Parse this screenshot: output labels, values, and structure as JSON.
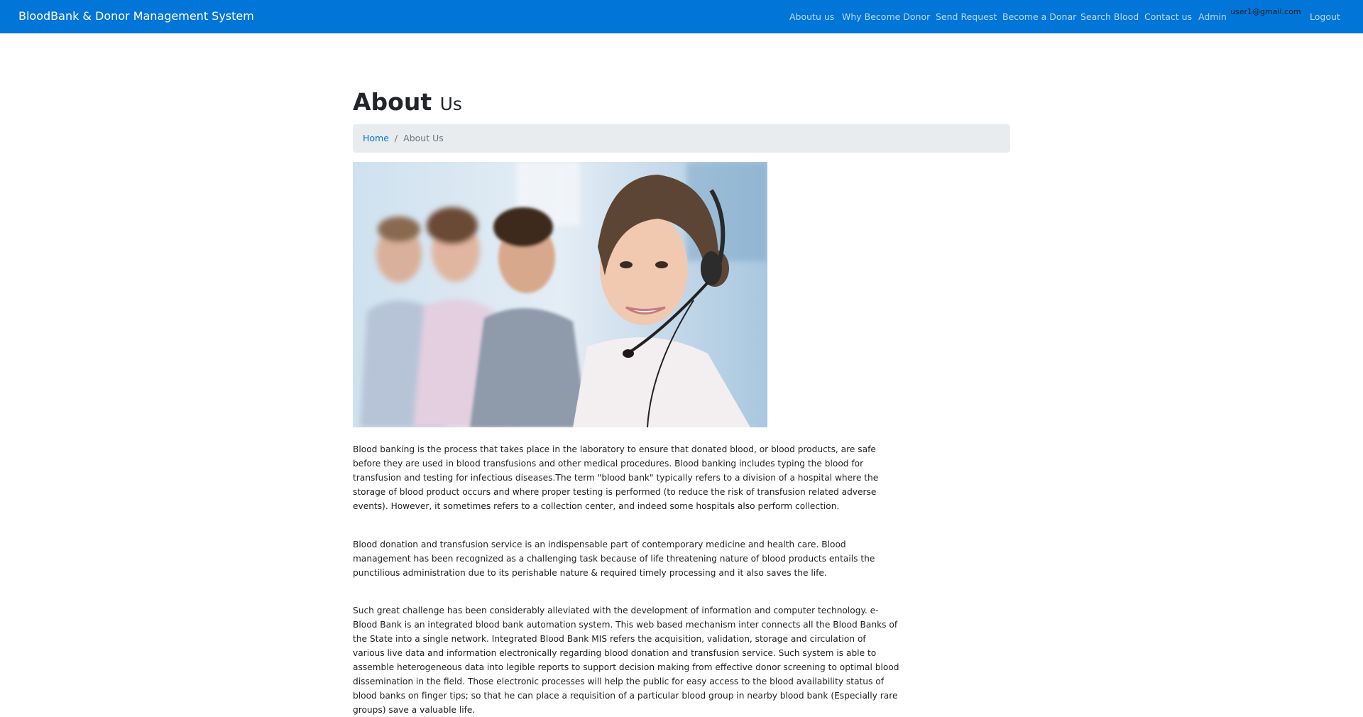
{
  "navbar": {
    "brand": "BloodBank & Donor Management System",
    "links": [
      "Aboutu us",
      "Why Become Donor",
      "Send Request",
      "Become a Donar",
      "Search Blood",
      "Contact us",
      "Admin"
    ],
    "user_email": "user1@gmail.com",
    "logout": "Logout",
    "background_color": "#0275d8"
  },
  "page": {
    "title": "About",
    "title_small": "Us"
  },
  "breadcrumb": {
    "home": "Home",
    "separator": "/",
    "current": "About Us"
  },
  "hero_image": {
    "icon": "call-center-photo"
  },
  "content": {
    "paragraphs": [
      "Blood banking is the process that takes place in the laboratory to ensure that donated blood, or blood products, are safe before they are used in blood transfusions and other medical procedures. Blood banking includes typing the blood for transfusion and testing for infectious diseases.The term \"blood bank\" typically refers to a division of a hospital where the storage of blood product occurs and where proper testing is performed (to reduce the risk of transfusion related adverse events). However, it sometimes refers to a collection center, and indeed some hospitals also perform collection.",
      "Blood donation and transfusion service is an indispensable part of contemporary medicine and health care. Blood management has been recognized as a challenging task because of life threatening nature of blood products entails the punctilious administration due to its perishable nature & required timely processing and it also saves the life.",
      "Such great challenge has been considerably alleviated with the development of information and computer technology. e-Blood Bank is an integrated blood bank automation system. This web based mechanism inter connects all the Blood Banks of the State into a single network. Integrated Blood Bank MIS refers the acquisition, validation, storage and circulation of various live data and information electronically regarding blood donation and transfusion service. Such system is able to assemble heterogeneous data into legible reports to support decision making from effective donor screening to optimal blood dissemination in the field. Those electronic processes will help the public for easy access to the blood availability status of blood banks on finger tips; so that he can place a requisition of a particular blood group in nearby blood bank (Especially rare groups) save a valuable life."
    ]
  }
}
